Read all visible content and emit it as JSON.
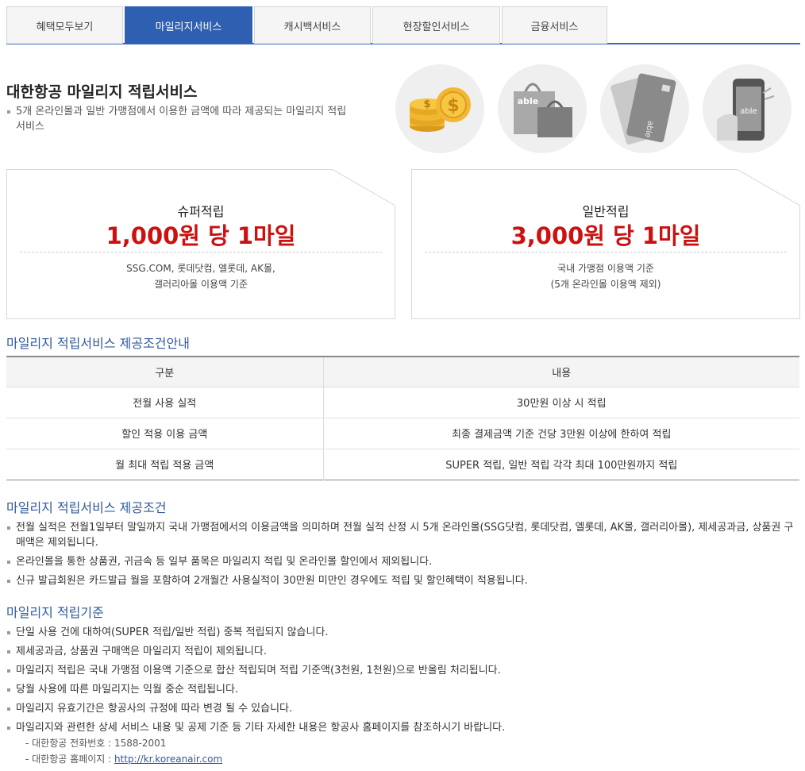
{
  "tabs": [
    {
      "label": "혜택모두보기",
      "active": false
    },
    {
      "label": "마일리지서비스",
      "active": true
    },
    {
      "label": "캐시백서비스",
      "active": false
    },
    {
      "label": "현장할인서비스",
      "active": false
    },
    {
      "label": "금융서비스",
      "active": false
    }
  ],
  "hero": {
    "title": "대한항공 마일리지 적립서비스",
    "desc": "5개 온라인몰과 일반 가맹점에서 이용한 금액에 따라 제공되는 마일리지 적립 서비스",
    "icons": [
      "coins-icon",
      "shopping-bag-icon",
      "credit-card-icon",
      "mobile-phone-icon"
    ],
    "bag_label": "able",
    "card_label": "able",
    "phone_label": "able"
  },
  "cards": [
    {
      "name": "슈퍼적립",
      "rate": "1,000원 당 1마일",
      "note1": "SSG.COM, 롯데닷컴, 엘롯데, AK몰,",
      "note2": "갤러리아몰 이용액 기준"
    },
    {
      "name": "일반적립",
      "rate": "3,000원 당 1마일",
      "note1": "국내 가맹점 이용액 기준",
      "note2": "(5개 온라인몰 이용액 제외)"
    }
  ],
  "conditions_guide": {
    "title": "마일리지 적립서비스 제공조건안내",
    "headers": [
      "구분",
      "내용"
    ],
    "rows": [
      [
        "전월 사용 실적",
        "30만원 이상 시 적립"
      ],
      [
        "할인 적용 이용 금액",
        "최종 결제금액 기준 건당 3만원 이상에 한하여 적립"
      ],
      [
        "월 최대 적립 적용 금액",
        "SUPER 적립, 일반 적립 각각 최대 100만원까지 적립"
      ]
    ]
  },
  "conditions": {
    "title": "마일리지 적립서비스 제공조건",
    "items": [
      "전월 실적은 전월1일부터 말일까지 국내 가맹점에서의 이용금액을 의미하며 전월 실적 산정 시 5개 온라인몰(SSG닷컴, 롯데닷컴, 엘롯데, AK몰, 갤러리아몰), 제세공과금, 상품권 구매액은 제외됩니다.",
      "온라인몰을 통한 상품권, 귀금속 등 일부 품목은 마일리지 적립 및 온라인몰 할인에서 제외됩니다.",
      "신규 발급회원은 카드발급 월을 포함하여 2개월간 사용실적이 30만원 미만인 경우에도 적립 및 할인혜택이 적용됩니다."
    ]
  },
  "criteria": {
    "title": "마일리지 적립기준",
    "items": [
      "단일 사용 건에 대하여(SUPER 적립/일반 적립) 중복 적립되지 않습니다.",
      "제세공과금, 상품권 구매액은 마일리지 적립이 제외됩니다.",
      "마일리지 적립은 국내 가맹점 이용액 기준으로 합산 적립되며 적립 기준액(3천원, 1천원)으로 반올림 처리됩니다.",
      "당월 사용에 따른 마일리지는 익월 중순 적립됩니다.",
      "마일리지 유효기간은 항공사의 규정에 따라 변경 될 수 있습니다.",
      "마일리지와 관련한 상세 서비스 내용 및 공제 기준 등 기타 자세한 내용은 항공사 홈페이지를 참조하시기 바랍니다."
    ],
    "phone_label": "- 대한항공 전화번호 : 1588-2001",
    "home_label": "- 대한항공 홈페이지 : ",
    "home_link": "http://kr.koreanair.com"
  },
  "colors": {
    "accent": "#2f5fb0",
    "rate_red": "#cc1111",
    "section_blue": "#2f5a9b"
  }
}
